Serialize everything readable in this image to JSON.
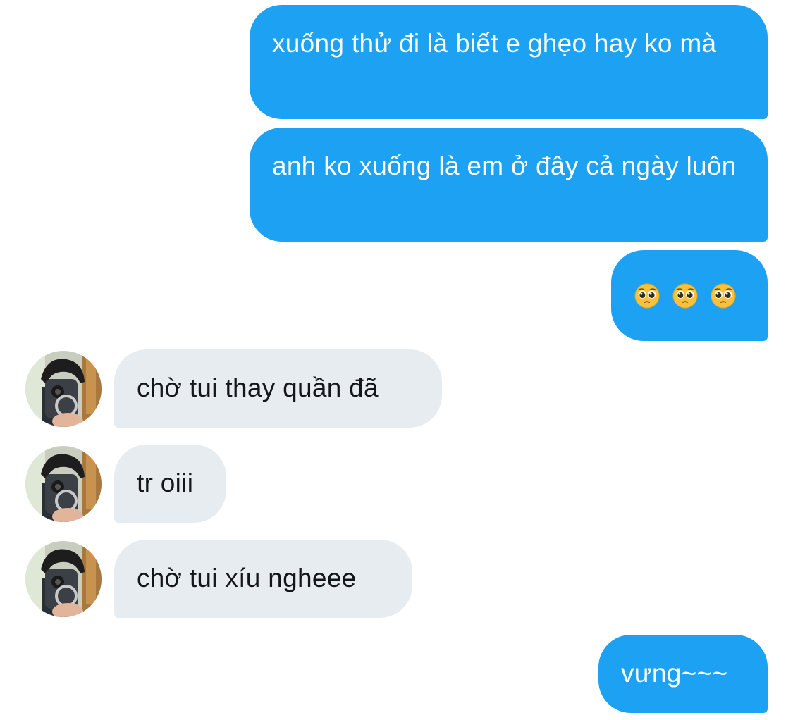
{
  "conversation": {
    "messages": [
      {
        "sender": "me",
        "text": "xuống thử đi là biết e ghẹo hay ko mà"
      },
      {
        "sender": "me",
        "text": "anh ko xuống là em ở đây cả ngày luôn"
      },
      {
        "sender": "me",
        "emoji": [
          "pleading-face",
          "pleading-face",
          "pleading-face"
        ]
      },
      {
        "sender": "them",
        "text": "chờ tui thay quần đã"
      },
      {
        "sender": "them",
        "text": "tr oiii"
      },
      {
        "sender": "them",
        "text": "chờ tui xíu ngheee"
      },
      {
        "sender": "me",
        "text": "vưng~~~"
      }
    ]
  },
  "colors": {
    "outgoing_bubble": "#1da1f2",
    "incoming_bubble": "#e6ecf0",
    "outgoing_text": "#ffffff",
    "incoming_text": "#14171a"
  }
}
